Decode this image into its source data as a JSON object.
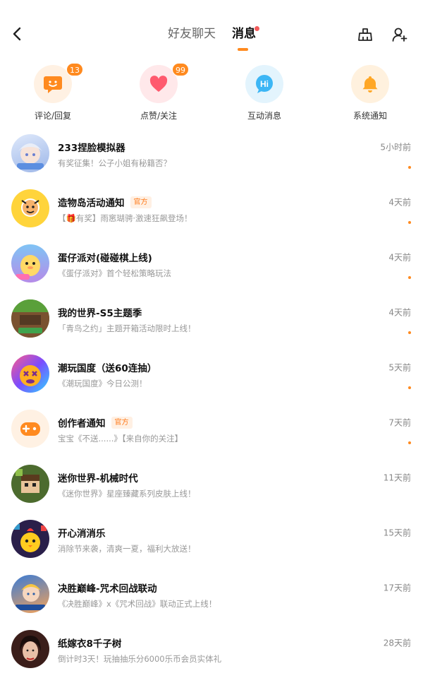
{
  "header": {
    "tabs": [
      {
        "label": "好友聊天",
        "active": false
      },
      {
        "label": "消息",
        "active": true,
        "has_dot": true
      }
    ],
    "icons": {
      "back": "chevron-left-icon",
      "cleanup": "broom-icon",
      "add_friend": "add-user-icon"
    },
    "accent_color": "#ff8a1f",
    "dot_color": "#f25c5c"
  },
  "categories": [
    {
      "label": "评论/回复",
      "badge": "13",
      "icon": "comment-icon",
      "color": "#ff8a1f"
    },
    {
      "label": "点赞/关注",
      "badge": "99",
      "icon": "heart-icon",
      "color": "#ff5a6e"
    },
    {
      "label": "互动消息",
      "badge": "",
      "icon": "hi-bubble-icon",
      "color": "#3cb6f5"
    },
    {
      "label": "系统通知",
      "badge": "",
      "icon": "bell-icon",
      "color": "#ffa726"
    }
  ],
  "messages": [
    {
      "title": "233捏脸模拟器",
      "official": false,
      "preview": "有奖征集！公子小姐有秘籍否？",
      "time": "5小时前",
      "unread": true
    },
    {
      "title": "造物岛活动通知",
      "official": true,
      "preview": "【🎁有奖】雨窸瑚骋·激速狂飙登场！",
      "time": "4天前",
      "unread": true
    },
    {
      "title": "蛋仔派对(碰碰棋上线)",
      "official": false,
      "preview": "《蛋仔派对》首个轻松策略玩法",
      "time": "4天前",
      "unread": true
    },
    {
      "title": "我的世界-S5主题季",
      "official": false,
      "preview": "「青鸟之约」主题开箱活动限时上线！",
      "time": "4天前",
      "unread": true
    },
    {
      "title": "潮玩国度（送60连抽）",
      "official": false,
      "preview": "《潮玩国度》今日公测！",
      "time": "5天前",
      "unread": true
    },
    {
      "title": "创作者通知",
      "official": true,
      "preview": "宝宝《不送......》【来自你的关注】",
      "time": "7天前",
      "unread": true
    },
    {
      "title": "迷你世界-机械时代",
      "official": false,
      "preview": "《迷你世界》星座臻藏系列皮肤上线！",
      "time": "11天前",
      "unread": false
    },
    {
      "title": "开心消消乐",
      "official": false,
      "preview": "消除节来袭，清爽一夏，福利大放送！",
      "time": "15天前",
      "unread": false
    },
    {
      "title": "决胜巅峰-咒术回战联动",
      "official": false,
      "preview": "《决胜巅峰》x《咒术回战》联动正式上线！",
      "time": "17天前",
      "unread": false
    },
    {
      "title": "纸嫁衣8千子树",
      "official": false,
      "preview": "倒计时3天！玩抽抽乐分6000乐币会员实体礼",
      "time": "28天前",
      "unread": false
    }
  ],
  "official_label": "官方"
}
